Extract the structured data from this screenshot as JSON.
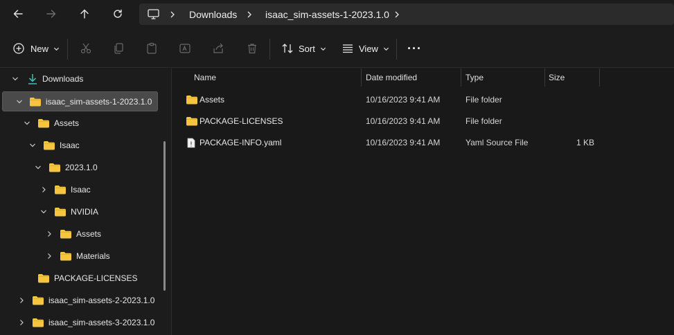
{
  "address": {
    "segments": [
      "Downloads",
      "isaac_sim-assets-1-2023.1.0"
    ]
  },
  "commands": {
    "new_label": "New",
    "sort_label": "Sort",
    "view_label": "View",
    "more_label": "···"
  },
  "tree": [
    {
      "label": "Downloads",
      "expanded": true
    },
    {
      "label": "isaac_sim-assets-1-2023.1.0",
      "expanded": true,
      "selected": true
    },
    {
      "label": "Assets",
      "expanded": true
    },
    {
      "label": "Isaac",
      "expanded": true
    },
    {
      "label": "2023.1.0",
      "expanded": true
    },
    {
      "label": "Isaac",
      "expanded": false
    },
    {
      "label": "NVIDIA",
      "expanded": true
    },
    {
      "label": "Assets",
      "expanded": false
    },
    {
      "label": "Materials",
      "expanded": false
    },
    {
      "label": "PACKAGE-LICENSES",
      "expanded": null
    },
    {
      "label": "isaac_sim-assets-2-2023.1.0",
      "expanded": false
    },
    {
      "label": "isaac_sim-assets-3-2023.1.0",
      "expanded": false
    }
  ],
  "columns": {
    "name": "Name",
    "date": "Date modified",
    "type": "Type",
    "size": "Size"
  },
  "files": [
    {
      "name": "Assets",
      "date": "10/16/2023 9:41 AM",
      "type": "File folder",
      "size": "",
      "icon": "folder-icon"
    },
    {
      "name": "PACKAGE-LICENSES",
      "date": "10/16/2023 9:41 AM",
      "type": "File folder",
      "size": "",
      "icon": "folder-icon"
    },
    {
      "name": "PACKAGE-INFO.yaml",
      "date": "10/16/2023 9:41 AM",
      "type": "Yaml Source File",
      "size": "1 KB",
      "icon": "yaml-file-icon"
    }
  ],
  "colors": {
    "folder": "#f5c542",
    "accent_download": "#3fb6a8"
  }
}
